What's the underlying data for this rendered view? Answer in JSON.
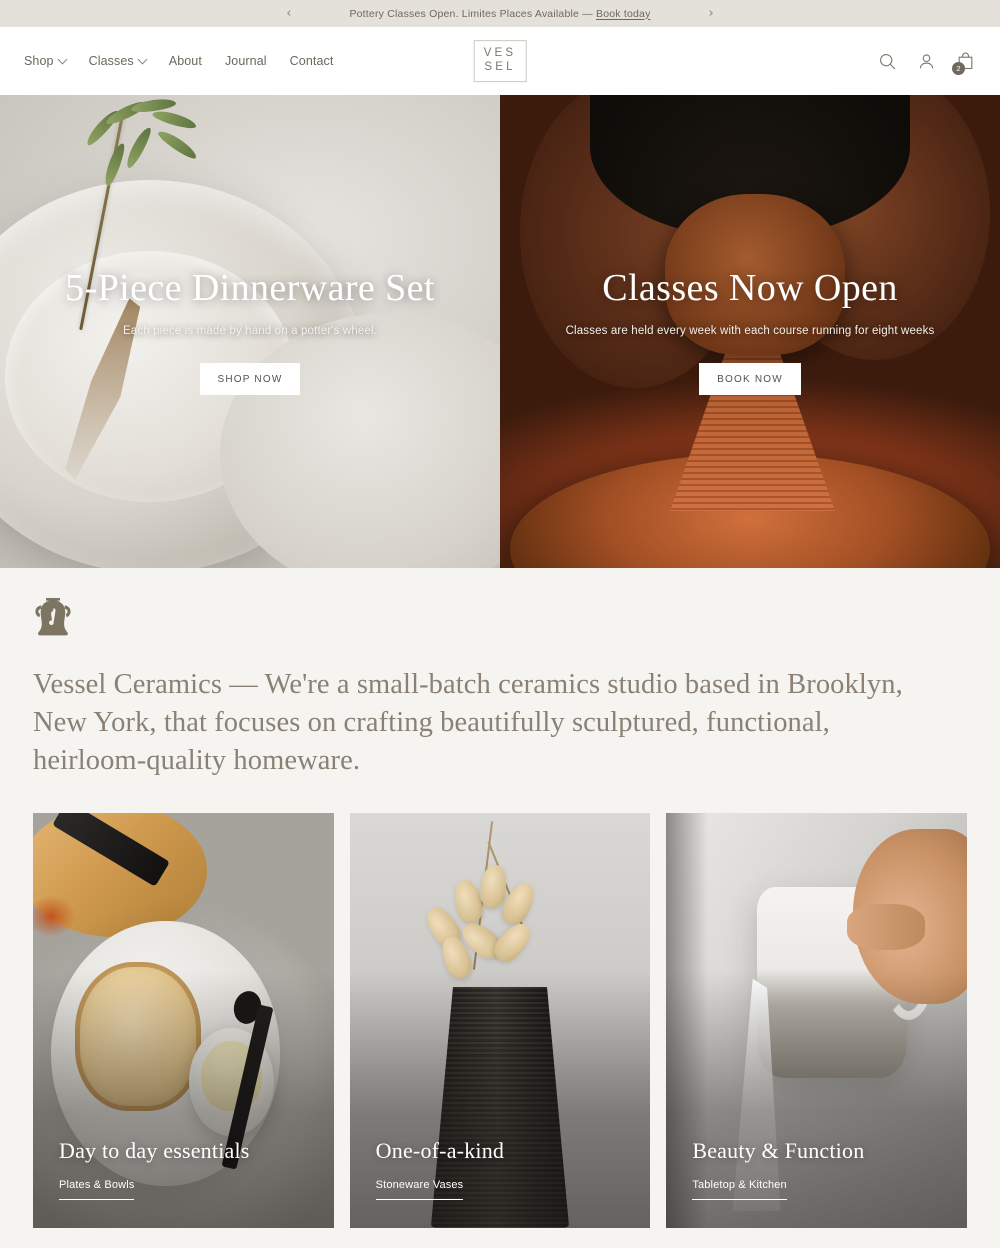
{
  "announcement": {
    "prev_icon": "chevron-left-icon",
    "next_icon": "chevron-right-icon",
    "text": "Pottery Classes Open. Limites Places Available — ",
    "link_label": "Book today"
  },
  "header": {
    "nav": [
      {
        "label": "Shop",
        "has_dropdown": true
      },
      {
        "label": "Classes",
        "has_dropdown": true
      },
      {
        "label": "About",
        "has_dropdown": false
      },
      {
        "label": "Journal",
        "has_dropdown": false
      },
      {
        "label": "Contact",
        "has_dropdown": false
      }
    ],
    "logo": {
      "line1": "VES",
      "line2": "SEL"
    },
    "icons": {
      "search": "search-icon",
      "account": "account-icon",
      "cart": "shopping-bag-icon",
      "cart_count": "2"
    }
  },
  "hero": {
    "panes": [
      {
        "title": "5-Piece Dinnerware Set",
        "subtitle": "Each piece is made by hand on a potter's wheel.",
        "button": "SHOP NOW"
      },
      {
        "title": "Classes Now Open",
        "subtitle": "Classes are held every week with each course running for eight weeks",
        "button": "BOOK NOW"
      }
    ]
  },
  "intro": {
    "icon": "amphora-vase-icon",
    "text": "Vessel Ceramics — We're a small-batch ceramics studio based in Brooklyn, New York, that focuses on crafting beautifully sculptured, functional, heirloom-quality homeware."
  },
  "categories": [
    {
      "title": "Day to day essentials",
      "link": "Plates & Bowls"
    },
    {
      "title": "One-of-a-kind",
      "link": "Stoneware Vases"
    },
    {
      "title": "Beauty & Function",
      "link": "Tabletop & Kitchen"
    }
  ],
  "colors": {
    "page_bg": "#f5f4f1",
    "announce_bg": "#e4e0da",
    "header_bg": "#ffffff",
    "text_muted": "#70695e",
    "intro_text": "#8a8174",
    "accent_icon": "#6f685c"
  }
}
